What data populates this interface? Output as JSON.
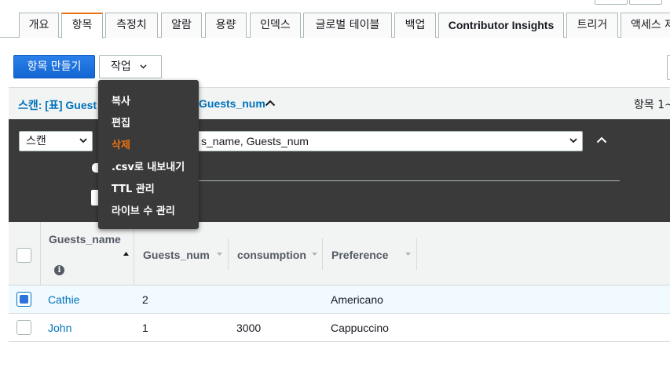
{
  "tabs": [
    {
      "label": "개요"
    },
    {
      "label": "항목"
    },
    {
      "label": "측정치"
    },
    {
      "label": "알람"
    },
    {
      "label": "용량"
    },
    {
      "label": "인덱스"
    },
    {
      "label": "글로벌 테이블"
    },
    {
      "label": "백업"
    },
    {
      "label": "Contributor Insights"
    },
    {
      "label": "트리거"
    },
    {
      "label": "액세스 제"
    }
  ],
  "toolbar": {
    "create_item_label": "항목 만들기",
    "actions_label": "작업"
  },
  "scan_header": {
    "title_prefix": "스캔: [표] Guest",
    "title_suffix": "Guests_num",
    "item_count": "항목 1~"
  },
  "scan_panel": {
    "mode_value": "스캔",
    "attributes_value": "s_name, Guests_num"
  },
  "actions_menu": {
    "items": [
      {
        "label": "복사"
      },
      {
        "label": "편집"
      },
      {
        "label": "삭제"
      },
      {
        "label": ".csv로 내보내기"
      },
      {
        "label": "TTL 관리"
      },
      {
        "label": "라이브 수 관리"
      }
    ],
    "danger_color": "#ec7211"
  },
  "table": {
    "columns": [
      {
        "label": "Guests_name"
      },
      {
        "label": "Guests_num"
      },
      {
        "label": "consumption"
      },
      {
        "label": "Preference"
      }
    ],
    "rows": [
      {
        "name": "Cathie",
        "num": "2",
        "consumption": "",
        "preference": "Americano",
        "selected": true
      },
      {
        "name": "John",
        "num": "1",
        "consumption": "3000",
        "preference": "Cappuccino",
        "selected": false
      }
    ]
  },
  "colors": {
    "primary": "#1a73e8",
    "link": "#0073bb",
    "tab_accent": "#ec7211",
    "panel_dark": "#3a3a3a"
  },
  "icons": [
    "chevron-down-icon",
    "chevron-up-icon",
    "info-icon",
    "sort-asc-icon",
    "sort-desc-icon"
  ]
}
